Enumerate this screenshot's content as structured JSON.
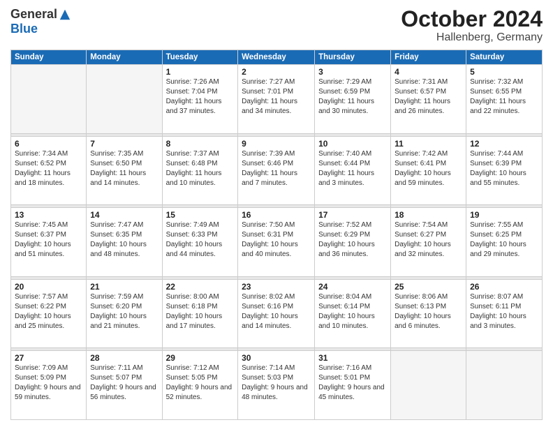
{
  "logo": {
    "general": "General",
    "blue": "Blue"
  },
  "title": "October 2024",
  "subtitle": "Hallenberg, Germany",
  "days_header": [
    "Sunday",
    "Monday",
    "Tuesday",
    "Wednesday",
    "Thursday",
    "Friday",
    "Saturday"
  ],
  "weeks": [
    [
      {
        "num": "",
        "sunrise": "",
        "sunset": "",
        "daylight": ""
      },
      {
        "num": "",
        "sunrise": "",
        "sunset": "",
        "daylight": ""
      },
      {
        "num": "1",
        "sunrise": "Sunrise: 7:26 AM",
        "sunset": "Sunset: 7:04 PM",
        "daylight": "Daylight: 11 hours and 37 minutes."
      },
      {
        "num": "2",
        "sunrise": "Sunrise: 7:27 AM",
        "sunset": "Sunset: 7:01 PM",
        "daylight": "Daylight: 11 hours and 34 minutes."
      },
      {
        "num": "3",
        "sunrise": "Sunrise: 7:29 AM",
        "sunset": "Sunset: 6:59 PM",
        "daylight": "Daylight: 11 hours and 30 minutes."
      },
      {
        "num": "4",
        "sunrise": "Sunrise: 7:31 AM",
        "sunset": "Sunset: 6:57 PM",
        "daylight": "Daylight: 11 hours and 26 minutes."
      },
      {
        "num": "5",
        "sunrise": "Sunrise: 7:32 AM",
        "sunset": "Sunset: 6:55 PM",
        "daylight": "Daylight: 11 hours and 22 minutes."
      }
    ],
    [
      {
        "num": "6",
        "sunrise": "Sunrise: 7:34 AM",
        "sunset": "Sunset: 6:52 PM",
        "daylight": "Daylight: 11 hours and 18 minutes."
      },
      {
        "num": "7",
        "sunrise": "Sunrise: 7:35 AM",
        "sunset": "Sunset: 6:50 PM",
        "daylight": "Daylight: 11 hours and 14 minutes."
      },
      {
        "num": "8",
        "sunrise": "Sunrise: 7:37 AM",
        "sunset": "Sunset: 6:48 PM",
        "daylight": "Daylight: 11 hours and 10 minutes."
      },
      {
        "num": "9",
        "sunrise": "Sunrise: 7:39 AM",
        "sunset": "Sunset: 6:46 PM",
        "daylight": "Daylight: 11 hours and 7 minutes."
      },
      {
        "num": "10",
        "sunrise": "Sunrise: 7:40 AM",
        "sunset": "Sunset: 6:44 PM",
        "daylight": "Daylight: 11 hours and 3 minutes."
      },
      {
        "num": "11",
        "sunrise": "Sunrise: 7:42 AM",
        "sunset": "Sunset: 6:41 PM",
        "daylight": "Daylight: 10 hours and 59 minutes."
      },
      {
        "num": "12",
        "sunrise": "Sunrise: 7:44 AM",
        "sunset": "Sunset: 6:39 PM",
        "daylight": "Daylight: 10 hours and 55 minutes."
      }
    ],
    [
      {
        "num": "13",
        "sunrise": "Sunrise: 7:45 AM",
        "sunset": "Sunset: 6:37 PM",
        "daylight": "Daylight: 10 hours and 51 minutes."
      },
      {
        "num": "14",
        "sunrise": "Sunrise: 7:47 AM",
        "sunset": "Sunset: 6:35 PM",
        "daylight": "Daylight: 10 hours and 48 minutes."
      },
      {
        "num": "15",
        "sunrise": "Sunrise: 7:49 AM",
        "sunset": "Sunset: 6:33 PM",
        "daylight": "Daylight: 10 hours and 44 minutes."
      },
      {
        "num": "16",
        "sunrise": "Sunrise: 7:50 AM",
        "sunset": "Sunset: 6:31 PM",
        "daylight": "Daylight: 10 hours and 40 minutes."
      },
      {
        "num": "17",
        "sunrise": "Sunrise: 7:52 AM",
        "sunset": "Sunset: 6:29 PM",
        "daylight": "Daylight: 10 hours and 36 minutes."
      },
      {
        "num": "18",
        "sunrise": "Sunrise: 7:54 AM",
        "sunset": "Sunset: 6:27 PM",
        "daylight": "Daylight: 10 hours and 32 minutes."
      },
      {
        "num": "19",
        "sunrise": "Sunrise: 7:55 AM",
        "sunset": "Sunset: 6:25 PM",
        "daylight": "Daylight: 10 hours and 29 minutes."
      }
    ],
    [
      {
        "num": "20",
        "sunrise": "Sunrise: 7:57 AM",
        "sunset": "Sunset: 6:22 PM",
        "daylight": "Daylight: 10 hours and 25 minutes."
      },
      {
        "num": "21",
        "sunrise": "Sunrise: 7:59 AM",
        "sunset": "Sunset: 6:20 PM",
        "daylight": "Daylight: 10 hours and 21 minutes."
      },
      {
        "num": "22",
        "sunrise": "Sunrise: 8:00 AM",
        "sunset": "Sunset: 6:18 PM",
        "daylight": "Daylight: 10 hours and 17 minutes."
      },
      {
        "num": "23",
        "sunrise": "Sunrise: 8:02 AM",
        "sunset": "Sunset: 6:16 PM",
        "daylight": "Daylight: 10 hours and 14 minutes."
      },
      {
        "num": "24",
        "sunrise": "Sunrise: 8:04 AM",
        "sunset": "Sunset: 6:14 PM",
        "daylight": "Daylight: 10 hours and 10 minutes."
      },
      {
        "num": "25",
        "sunrise": "Sunrise: 8:06 AM",
        "sunset": "Sunset: 6:13 PM",
        "daylight": "Daylight: 10 hours and 6 minutes."
      },
      {
        "num": "26",
        "sunrise": "Sunrise: 8:07 AM",
        "sunset": "Sunset: 6:11 PM",
        "daylight": "Daylight: 10 hours and 3 minutes."
      }
    ],
    [
      {
        "num": "27",
        "sunrise": "Sunrise: 7:09 AM",
        "sunset": "Sunset: 5:09 PM",
        "daylight": "Daylight: 9 hours and 59 minutes."
      },
      {
        "num": "28",
        "sunrise": "Sunrise: 7:11 AM",
        "sunset": "Sunset: 5:07 PM",
        "daylight": "Daylight: 9 hours and 56 minutes."
      },
      {
        "num": "29",
        "sunrise": "Sunrise: 7:12 AM",
        "sunset": "Sunset: 5:05 PM",
        "daylight": "Daylight: 9 hours and 52 minutes."
      },
      {
        "num": "30",
        "sunrise": "Sunrise: 7:14 AM",
        "sunset": "Sunset: 5:03 PM",
        "daylight": "Daylight: 9 hours and 48 minutes."
      },
      {
        "num": "31",
        "sunrise": "Sunrise: 7:16 AM",
        "sunset": "Sunset: 5:01 PM",
        "daylight": "Daylight: 9 hours and 45 minutes."
      },
      {
        "num": "",
        "sunrise": "",
        "sunset": "",
        "daylight": ""
      },
      {
        "num": "",
        "sunrise": "",
        "sunset": "",
        "daylight": ""
      }
    ]
  ]
}
